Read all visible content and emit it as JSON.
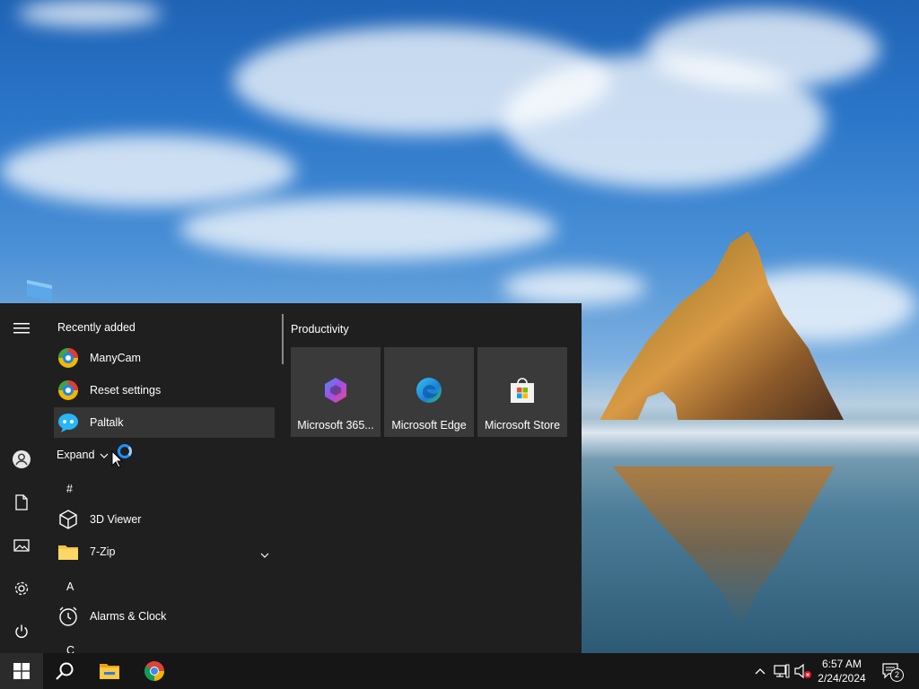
{
  "start_menu": {
    "recently_added_title": "Recently added",
    "recent_apps": [
      {
        "label": "ManyCam",
        "icon": "manycam-icon"
      },
      {
        "label": "Reset settings",
        "icon": "manycam-icon"
      },
      {
        "label": "Paltalk",
        "icon": "paltalk-icon"
      }
    ],
    "expand_label": "Expand",
    "letters": {
      "hash": "#",
      "a": "A",
      "c": "C"
    },
    "apps": [
      {
        "label": "3D Viewer",
        "icon": "3d-viewer-icon"
      },
      {
        "label": "7-Zip",
        "icon": "folder-icon"
      },
      {
        "label": "Alarms & Clock",
        "icon": "alarm-clock-icon"
      }
    ],
    "group_title": "Productivity",
    "tiles": [
      {
        "label": "Microsoft 365...",
        "icon": "microsoft-365-icon"
      },
      {
        "label": "Microsoft Edge",
        "icon": "edge-icon"
      },
      {
        "label": "Microsoft Store",
        "icon": "store-icon"
      }
    ],
    "rail_icons": [
      "hamburger-icon",
      "user-icon",
      "documents-icon",
      "pictures-icon",
      "settings-icon",
      "power-icon"
    ]
  },
  "taskbar": {
    "pinned": [
      "windows-start-icon",
      "search-icon",
      "file-explorer-icon",
      "chrome-icon"
    ],
    "tray": [
      "chevron-up-icon",
      "network-icon",
      "volume-muted-icon"
    ],
    "time": "6:57 AM",
    "date": "2/24/2024",
    "notification_count": "2"
  },
  "colors": {
    "menu_bg": "#1f1f1f",
    "tile_bg": "#3a3a3a",
    "taskbar_bg": "#161616",
    "accent": "#1e90ff"
  }
}
